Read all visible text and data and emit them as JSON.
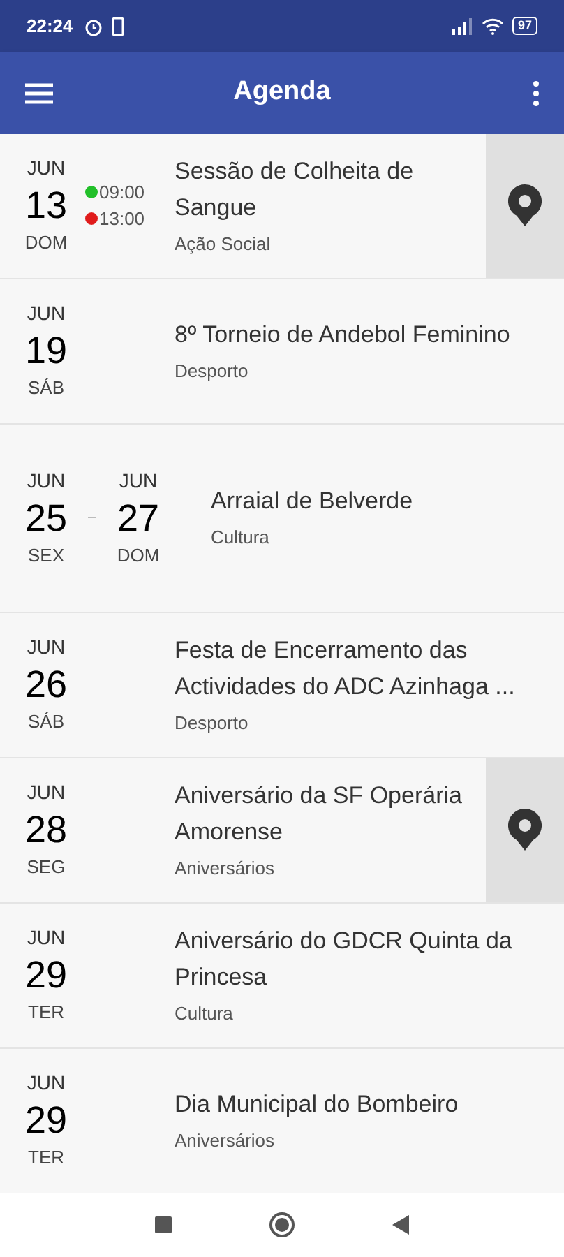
{
  "status_bar": {
    "time": "22:24",
    "battery": "97"
  },
  "app_bar": {
    "title": "Agenda"
  },
  "events": [
    {
      "start": {
        "month": "JUN",
        "day": "13",
        "weekday": "DOM"
      },
      "times": [
        {
          "time": "09:00",
          "color": "#22c02a"
        },
        {
          "time": "13:00",
          "color": "#e01b1b"
        }
      ],
      "title": "Sessão de Colheita de Sangue",
      "category": "Ação Social",
      "has_location": true
    },
    {
      "start": {
        "month": "JUN",
        "day": "19",
        "weekday": "SÁB"
      },
      "title": "8º Torneio de Andebol Feminino",
      "category": "Desporto",
      "has_location": false
    },
    {
      "start": {
        "month": "JUN",
        "day": "25",
        "weekday": "SEX"
      },
      "end": {
        "month": "JUN",
        "day": "27",
        "weekday": "DOM"
      },
      "title": "Arraial de Belverde",
      "category": "Cultura",
      "has_location": false
    },
    {
      "start": {
        "month": "JUN",
        "day": "26",
        "weekday": "SÁB"
      },
      "title": "Festa de Encerramento das Actividades do ADC Azinhaga ...",
      "category": "Desporto",
      "has_location": false
    },
    {
      "start": {
        "month": "JUN",
        "day": "28",
        "weekday": "SEG"
      },
      "title": "Aniversário da SF Operária Amorense",
      "category": "Aniversários",
      "has_location": true
    },
    {
      "start": {
        "month": "JUN",
        "day": "29",
        "weekday": "TER"
      },
      "title": "Aniversário do GDCR Quinta da Princesa",
      "category": "Cultura",
      "has_location": false
    },
    {
      "start": {
        "month": "JUN",
        "day": "29",
        "weekday": "TER"
      },
      "title": "Dia Municipal do Bombeiro",
      "category": "Aniversários",
      "has_location": false
    }
  ]
}
